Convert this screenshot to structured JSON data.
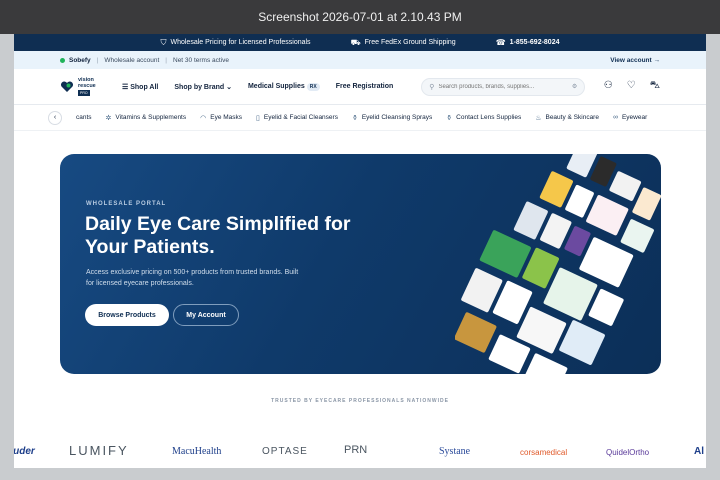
{
  "window": {
    "title": "Screenshot 2026-07-01 at 2.10.43 PM"
  },
  "topbar": {
    "items": [
      {
        "icon": "shield-check-icon",
        "text": "Wholesale Pricing for Licensed Professionals"
      },
      {
        "icon": "truck-icon",
        "text": "Free FedEx Ground Shipping"
      },
      {
        "icon": "headset-icon",
        "text": "1-855-692-8024"
      }
    ]
  },
  "account_bar": {
    "name": "Sobefy",
    "account_type": "Wholesale account",
    "terms": "Net 30 terms active",
    "view_link": "View account →"
  },
  "header": {
    "logo": {
      "line1": "vision",
      "line2": "rescue",
      "badge": "PRO"
    },
    "nav": {
      "shop_all": "Shop All",
      "shop_by_brand": "Shop by Brand",
      "medical_supplies": "Medical Supplies",
      "medical_chip": "RX",
      "free_registration": "Free Registration"
    },
    "search": {
      "placeholder": "Search products, brands, supplies..."
    }
  },
  "categories": [
    {
      "label": "cants",
      "icon": ""
    },
    {
      "label": "Vitamins & Supplements",
      "icon": "pill-icon"
    },
    {
      "label": "Eye Masks",
      "icon": "mask-icon"
    },
    {
      "label": "Eyelid & Facial Cleansers",
      "icon": "tube-icon"
    },
    {
      "label": "Eyelid Cleansing Sprays",
      "icon": "spray-icon"
    },
    {
      "label": "Contact Lens Supplies",
      "icon": "bottle-icon"
    },
    {
      "label": "Beauty & Skincare",
      "icon": "lotion-icon"
    },
    {
      "label": "Eyewear",
      "icon": "glasses-icon"
    }
  ],
  "hero": {
    "eyebrow": "WHOLESALE PORTAL",
    "headline": "Daily Eye Care Simplified for Your Patients.",
    "lead": "Access exclusive pricing on 500+ products from trusted brands. Built for licensed eyecare professionals.",
    "primary_button": "Browse Products",
    "secondary_button": "My Account"
  },
  "trusted": {
    "heading": "TRUSTED BY EYECARE PROFESSIONALS NATIONWIDE"
  },
  "brands": [
    "Bruder",
    "LUMIFY",
    "MacuHealth",
    "OPTASE",
    "PRN",
    "Systane",
    "corsamedical",
    "QuidelOrtho",
    "Al"
  ],
  "colors": {
    "navy": "#0f2e52",
    "hero_blue": "#114074",
    "accent_green": "#21b35a"
  }
}
